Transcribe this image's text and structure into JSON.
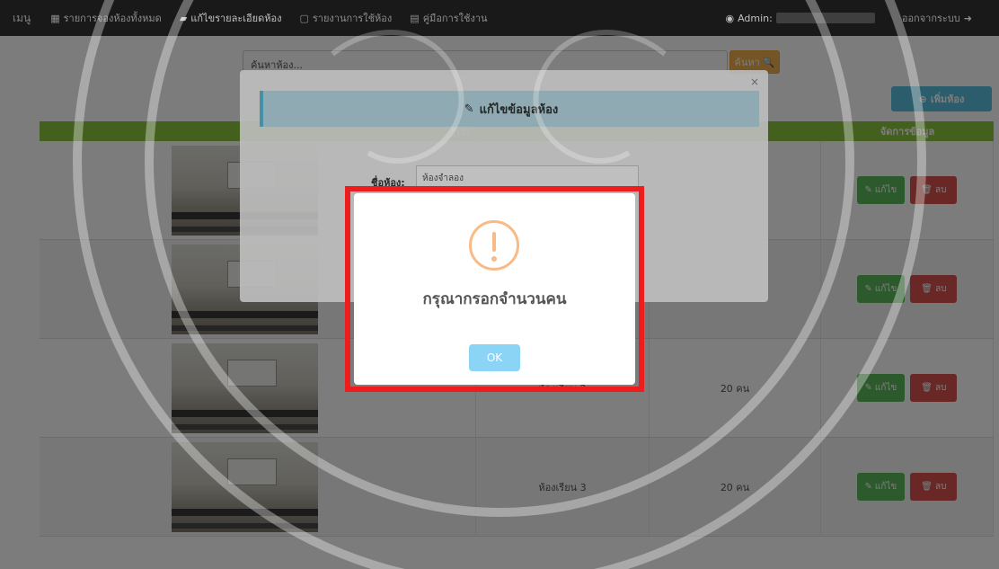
{
  "navbar": {
    "brand": "เมนู",
    "items": [
      {
        "label": "รายการจองห้องทั้งหมด",
        "icon": "grid-icon"
      },
      {
        "label": "แก้ไขรายละเอียดห้อง",
        "icon": "book-icon"
      },
      {
        "label": "รายงานการใช้ห้อง",
        "icon": "file-icon"
      },
      {
        "label": "คู่มือการใช้งาน",
        "icon": "file-icon"
      }
    ],
    "admin_label": "Admin:",
    "logout_label": "ออกจากระบบ"
  },
  "search": {
    "placeholder": "ค้นหาห้อง...",
    "button_label": "ค้นหา"
  },
  "add_room_label": "เพิ่มห้อง",
  "table": {
    "headers": [
      "รูปภ",
      "",
      "",
      "จัดการข้อมูล"
    ],
    "rows": [
      {
        "name": "",
        "capacity": ""
      },
      {
        "name": "",
        "capacity": ""
      },
      {
        "name": "ห้องเรียน 2",
        "capacity": "20 คน"
      },
      {
        "name": "ห้องเรียน 3",
        "capacity": "20 คน"
      }
    ],
    "edit_label": "แก้ไข",
    "delete_label": "ลบ"
  },
  "edit_modal": {
    "title": "แก้ไขข้อมูลห้อง",
    "close": "×",
    "field_label": "ชื่อห้อง:",
    "field_value": "ห้องจำลอง"
  },
  "alert": {
    "title": "กรุณากรอกจำนวนคน",
    "ok_label": "OK"
  },
  "colors": {
    "header_green": "#8dc63f",
    "alert_red_frame": "#ee1c1c",
    "warning_orange": "#f8bb86",
    "ok_blue": "#8cd4f5"
  }
}
